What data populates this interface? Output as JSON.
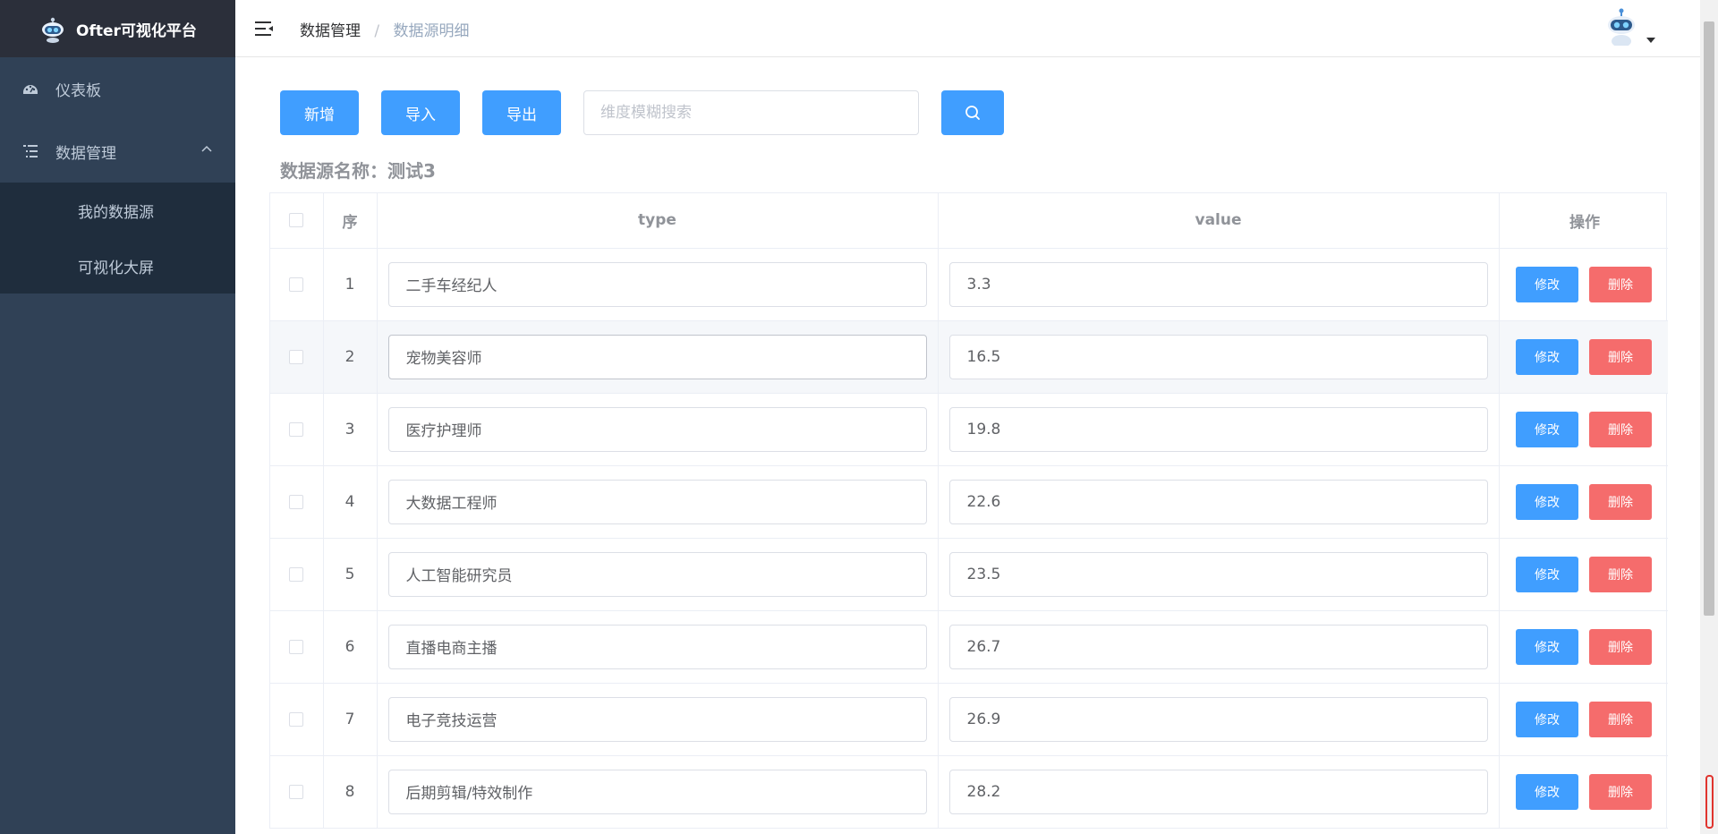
{
  "app": {
    "title": "Ofter可视化平台",
    "logo_icon": "robot-logo-icon"
  },
  "sidebar": {
    "items": [
      {
        "label": "仪表板",
        "icon": "dashboard-icon"
      },
      {
        "label": "数据管理",
        "icon": "list-tree-icon",
        "expanded": true,
        "children": [
          {
            "label": "我的数据源"
          },
          {
            "label": "可视化大屏"
          }
        ]
      }
    ]
  },
  "breadcrumb": {
    "first": "数据管理",
    "separator": "/",
    "last": "数据源明细"
  },
  "toolbar": {
    "add_label": "新增",
    "import_label": "导入",
    "export_label": "导出",
    "search_placeholder": "维度模糊搜索"
  },
  "datasource": {
    "title": "数据源名称：测试3"
  },
  "table": {
    "headers": {
      "index": "序",
      "type": "type",
      "value": "value",
      "ops": "操作"
    },
    "edit_label": "修改",
    "delete_label": "删除",
    "rows": [
      {
        "index": "1",
        "type": "二手车经纪人",
        "value": "3.3"
      },
      {
        "index": "2",
        "type": "宠物美容师",
        "value": "16.5"
      },
      {
        "index": "3",
        "type": "医疗护理师",
        "value": "19.8"
      },
      {
        "index": "4",
        "type": "大数据工程师",
        "value": "22.6"
      },
      {
        "index": "5",
        "type": "人工智能研究员",
        "value": "23.5"
      },
      {
        "index": "6",
        "type": "直播电商主播",
        "value": "26.7"
      },
      {
        "index": "7",
        "type": "电子竞技运营",
        "value": "26.9"
      },
      {
        "index": "8",
        "type": "后期剪辑/特效制作",
        "value": "28.2"
      }
    ]
  },
  "colors": {
    "primary": "#409eff",
    "danger": "#f56c6c",
    "sidebar_bg": "#304156",
    "logo_bg": "#2b2f3a",
    "submenu_bg": "#1f2d3d"
  }
}
